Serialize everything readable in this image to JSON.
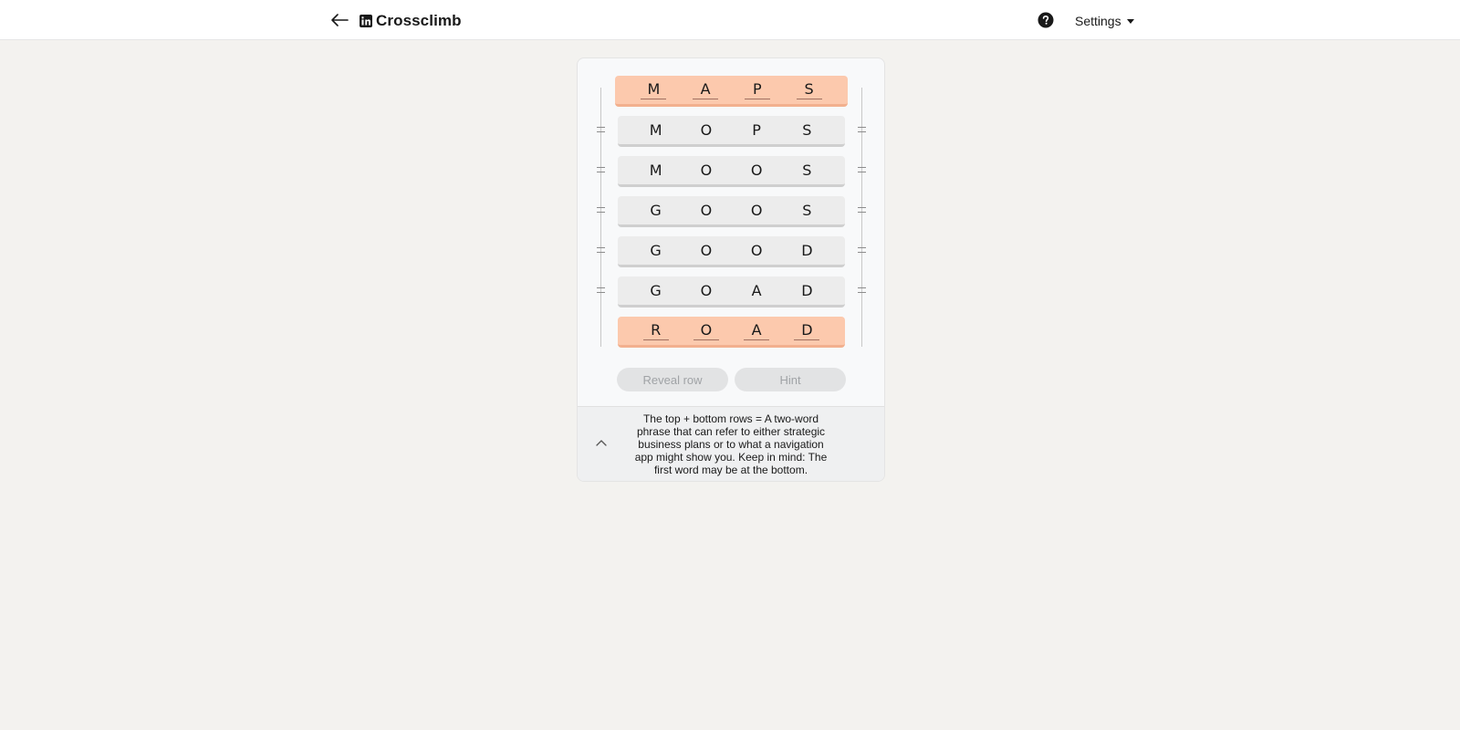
{
  "header": {
    "title": "Crossclimb",
    "settings_label": "Settings"
  },
  "rows": [
    {
      "letters": [
        "M",
        "A",
        "P",
        "S"
      ],
      "locked": true
    },
    {
      "letters": [
        "M",
        "O",
        "P",
        "S"
      ],
      "locked": false
    },
    {
      "letters": [
        "M",
        "O",
        "O",
        "S"
      ],
      "locked": false
    },
    {
      "letters": [
        "G",
        "O",
        "O",
        "S"
      ],
      "locked": false
    },
    {
      "letters": [
        "G",
        "O",
        "O",
        "D"
      ],
      "locked": false
    },
    {
      "letters": [
        "G",
        "O",
        "A",
        "D"
      ],
      "locked": false
    },
    {
      "letters": [
        "R",
        "O",
        "A",
        "D"
      ],
      "locked": true
    }
  ],
  "actions": {
    "reveal_label": "Reveal row",
    "hint_label": "Hint"
  },
  "clue": {
    "text": "The top + bottom rows = A two-word phrase that can refer to either strategic business plans or to what a navigation app might show you. Keep in mind: The first word may be at the bottom."
  },
  "colors": {
    "locked_row": "#fcc9ad",
    "row": "#ececec",
    "background": "#f3f2ef"
  }
}
